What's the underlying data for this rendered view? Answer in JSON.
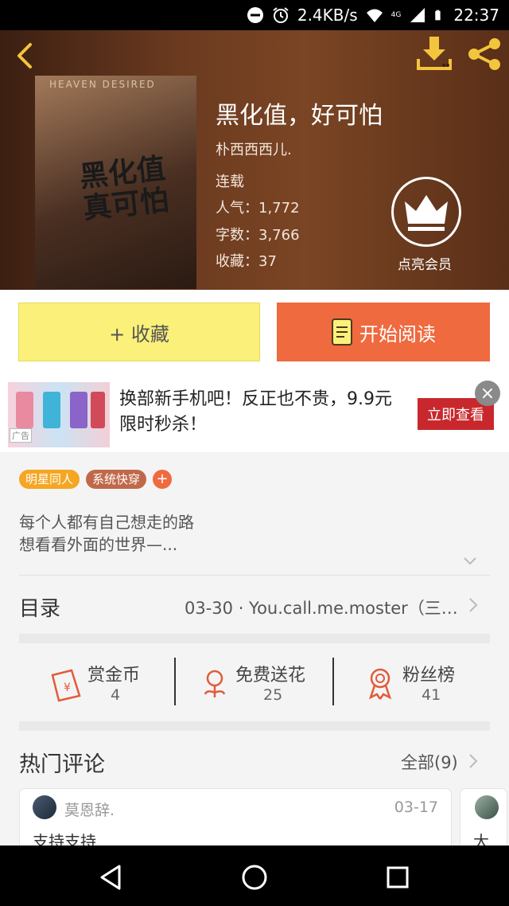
{
  "status_bar": {
    "network_speed": "2.4KB/s",
    "time": "22:37",
    "network_type": "4G",
    "icons": [
      "dnd-icon",
      "alarm-icon",
      "wifi-icon",
      "signal-icon",
      "battery-icon"
    ]
  },
  "header": {
    "back_icon": "chevron-left-icon",
    "download_icon": "download-icon",
    "share_icon": "share-icon",
    "accent_color": "#f3c53c"
  },
  "book": {
    "title": "黑化值，好可怕",
    "cover_title": "黑化值 真可怕",
    "author": "朴西西西儿.",
    "status": "连载",
    "popularity_label": "人气：",
    "popularity": "1,772",
    "word_count_label": "字数：",
    "word_count": "3,766",
    "favorites_label": "收藏：",
    "favorites": "37",
    "vip_label": "点亮会员"
  },
  "actions": {
    "collect_label": "+ 收藏",
    "read_label": "开始阅读"
  },
  "ad": {
    "text": "换部新手机吧！反正也不贵，9.9元限时秒杀！",
    "button_label": "立即查看",
    "tag": "广告",
    "close_icon": "close-icon"
  },
  "tags": [
    {
      "label": "明星同人",
      "color": "#f5a623"
    },
    {
      "label": "系统快穿",
      "color": "#c0694a"
    }
  ],
  "description": {
    "line1": "每个人都有自己想走的路",
    "line2": "想看看外面的世界—..."
  },
  "toc": {
    "label": "目录",
    "latest": "03-30 · You.call.me.moster（三…"
  },
  "stats": [
    {
      "label": "赏金币",
      "value": "4",
      "icon": "red-envelope-icon"
    },
    {
      "label": "免费送花",
      "value": "25",
      "icon": "flower-icon"
    },
    {
      "label": "粉丝榜",
      "value": "41",
      "icon": "medal-icon"
    }
  ],
  "comments": {
    "title": "热门评论",
    "all_label": "全部(9)",
    "items": [
      {
        "user": "莫恩辞.",
        "date": "03-17",
        "text": "支持支持"
      },
      {
        "user": "",
        "date": "",
        "text": "大"
      }
    ]
  },
  "nav_bar": {
    "icons": [
      "back-triangle-icon",
      "home-circle-icon",
      "recents-square-icon"
    ]
  }
}
